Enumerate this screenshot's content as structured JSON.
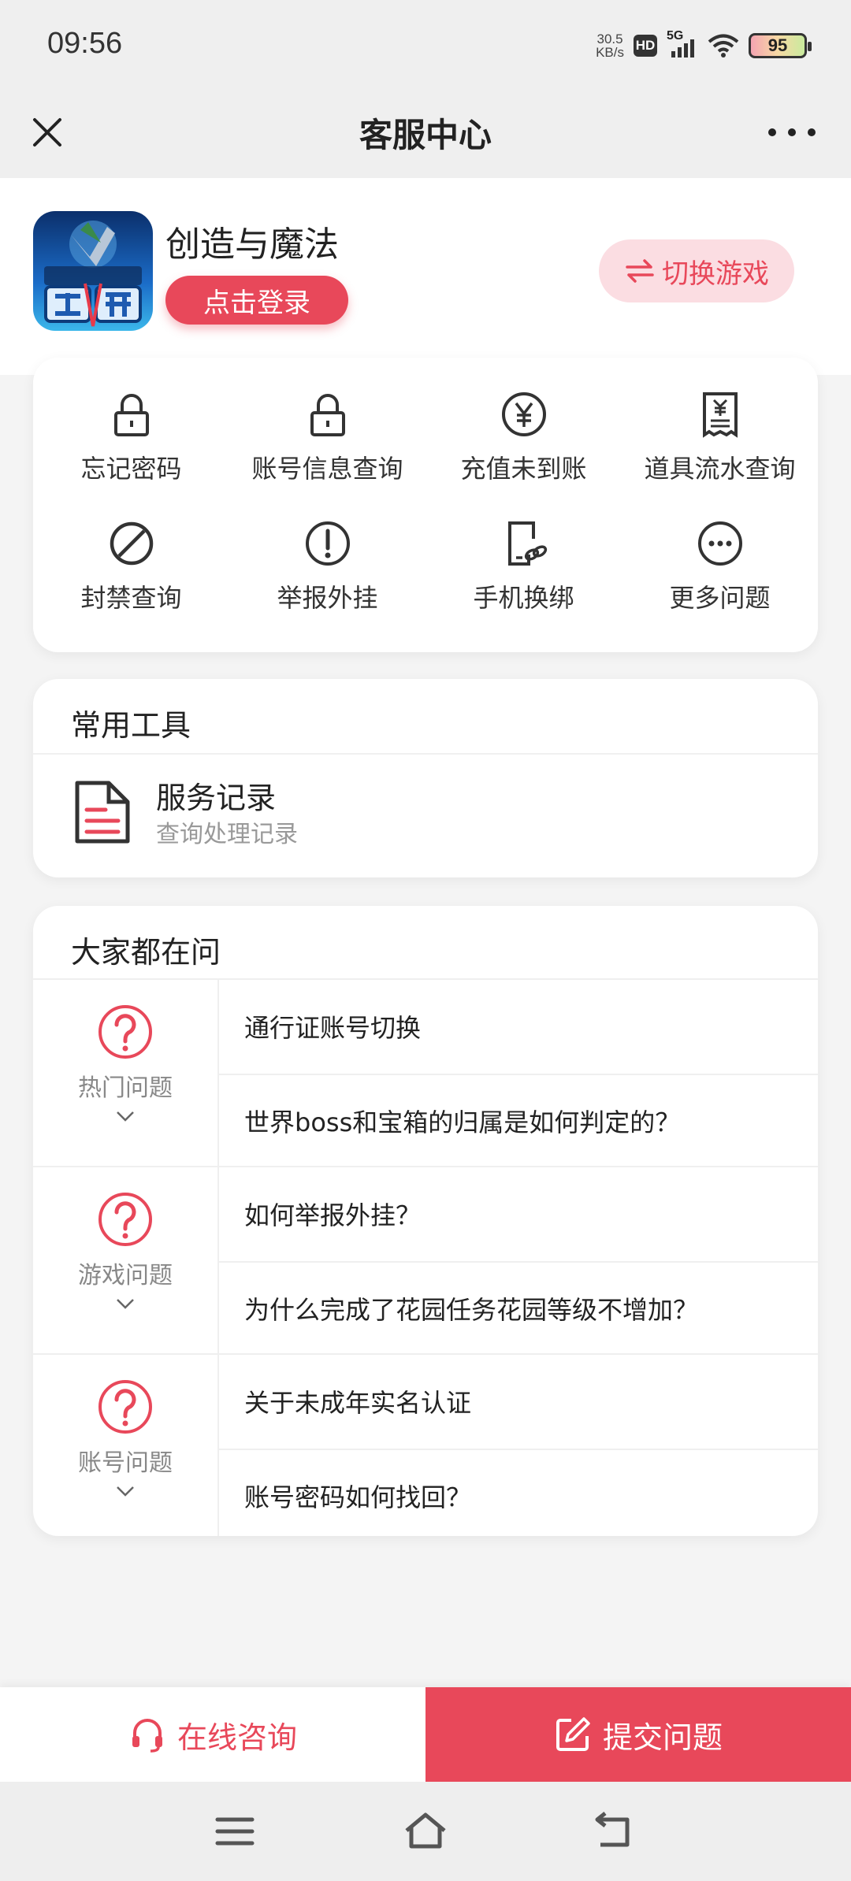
{
  "status_bar": {
    "time": "09:56",
    "net_speed_value": "30.5",
    "net_speed_unit": "KB/s",
    "hd_badge": "HD",
    "network_type": "5G",
    "battery_level": "95"
  },
  "nav": {
    "title": "客服中心",
    "close_icon": "close-icon",
    "more_icon": "more-icon"
  },
  "game": {
    "name": "创造与魔法",
    "login_label": "点击登录",
    "switch_label": "切换游戏"
  },
  "services": [
    {
      "label": "忘记密码",
      "icon": "lock-icon"
    },
    {
      "label": "账号信息查询",
      "icon": "lock-icon"
    },
    {
      "label": "充值未到账",
      "icon": "yen-icon"
    },
    {
      "label": "道具流水查询",
      "icon": "receipt-icon"
    },
    {
      "label": "封禁查询",
      "icon": "ban-icon"
    },
    {
      "label": "举报外挂",
      "icon": "alert-icon"
    },
    {
      "label": "手机换绑",
      "icon": "phone-link-icon"
    },
    {
      "label": "更多问题",
      "icon": "more-circle-icon"
    }
  ],
  "tools": {
    "title": "常用工具",
    "items": [
      {
        "title": "服务记录",
        "subtitle": "查询处理记录",
        "icon": "document-icon"
      }
    ]
  },
  "faq": {
    "title": "大家都在问",
    "groups": [
      {
        "category": "热门问题",
        "questions": [
          "通行证账号切换",
          "世界boss和宝箱的归属是如何判定的？"
        ]
      },
      {
        "category": "游戏问题",
        "questions": [
          "如何举报外挂？",
          "为什么完成了花园任务花园等级不增加？"
        ]
      },
      {
        "category": "账号问题",
        "questions": [
          "关于未成年实名认证",
          "账号密码如何找回？"
        ]
      }
    ]
  },
  "bottom_bar": {
    "consult_label": "在线咨询",
    "submit_label": "提交问题"
  },
  "colors": {
    "accent": "#e8485a",
    "accent_light": "#fbdde2",
    "background": "#f4f4f4"
  }
}
